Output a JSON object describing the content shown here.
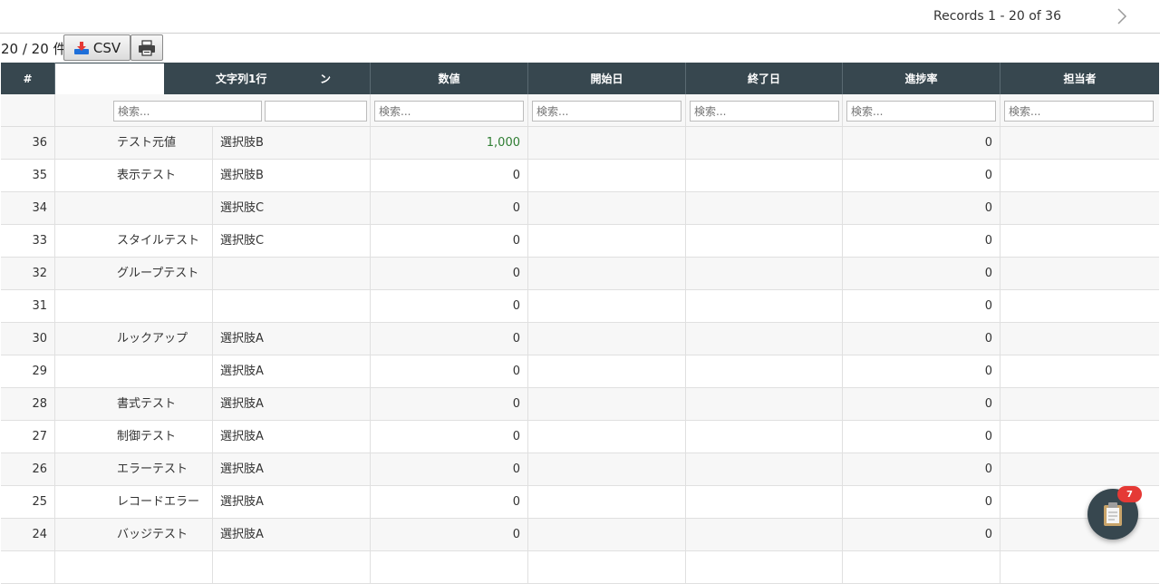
{
  "pagination": {
    "records_text": "Records 1 - 20 of 36"
  },
  "toolbar": {
    "count_text": "20 / 20 件",
    "csv_label": "CSV"
  },
  "table": {
    "headers": {
      "index": "#",
      "text_col": "文字列1行",
      "text_col_suffix": "ン",
      "number": "数値",
      "start_date": "開始日",
      "end_date": "終了日",
      "progress": "進捗率",
      "owner": "担当者"
    },
    "filter_placeholder": "検索...",
    "rows": [
      {
        "id": "36",
        "text": "テスト元値",
        "choice": "選択肢B",
        "number": "1,000",
        "progress": "0"
      },
      {
        "id": "35",
        "text": "表示テスト",
        "choice": "選択肢B",
        "number": "0",
        "progress": "0"
      },
      {
        "id": "34",
        "text": "",
        "choice": "選択肢C",
        "number": "0",
        "progress": "0"
      },
      {
        "id": "33",
        "text": "スタイルテスト",
        "choice": "選択肢C",
        "number": "0",
        "progress": "0"
      },
      {
        "id": "32",
        "text": "グループテスト",
        "choice": "",
        "number": "0",
        "progress": "0"
      },
      {
        "id": "31",
        "text": "",
        "choice": "",
        "number": "0",
        "progress": "0"
      },
      {
        "id": "30",
        "text": "ルックアップ",
        "choice": "選択肢A",
        "number": "0",
        "progress": "0"
      },
      {
        "id": "29",
        "text": "",
        "choice": "選択肢A",
        "number": "0",
        "progress": "0"
      },
      {
        "id": "28",
        "text": "書式テスト",
        "choice": "選択肢A",
        "number": "0",
        "progress": "0"
      },
      {
        "id": "27",
        "text": "制御テスト",
        "choice": "選択肢A",
        "number": "0",
        "progress": "0"
      },
      {
        "id": "26",
        "text": "エラーテスト",
        "choice": "選択肢A",
        "number": "0",
        "progress": "0"
      },
      {
        "id": "25",
        "text": "レコードエラー",
        "choice": "選択肢A",
        "number": "0",
        "progress": "0"
      },
      {
        "id": "24",
        "text": "バッジテスト",
        "choice": "選択肢A",
        "number": "0",
        "progress": "0"
      },
      {
        "id": "",
        "text": "",
        "choice": "",
        "number": "",
        "progress": ""
      }
    ]
  },
  "fab": {
    "icon": "clipboard-icon",
    "badge": "7"
  },
  "colors": {
    "header_bg": "#37474f",
    "accent_green": "#2e7d32",
    "badge_red": "#e53935"
  }
}
